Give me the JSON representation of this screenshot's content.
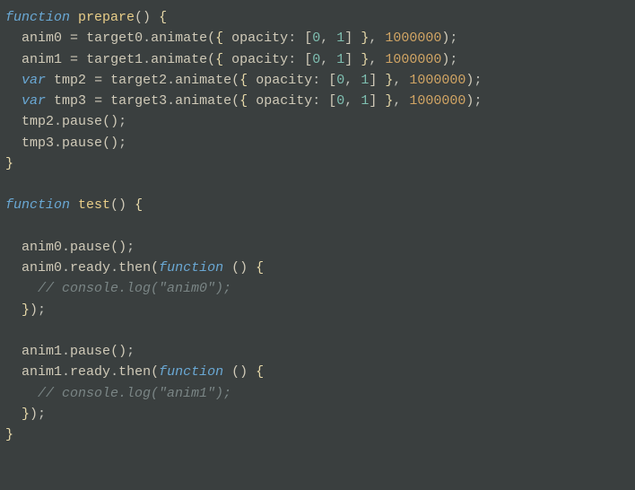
{
  "code": {
    "fn1_keyword": "function",
    "fn1_name": "prepare",
    "fn2_keyword": "function",
    "fn2_name": "test",
    "var_keyword": "var",
    "anim0": "anim0",
    "anim1": "anim1",
    "tmp2": "tmp2",
    "tmp3": "tmp3",
    "target0": "target0",
    "target1": "target1",
    "target2": "target2",
    "target3": "target3",
    "animate": "animate",
    "pause": "pause",
    "ready": "ready",
    "then": "then",
    "opacity": "opacity",
    "zero": "0",
    "one": "1",
    "duration": "1000000",
    "anon_fn": "function",
    "comment0": "// console.log(\"anim0\");",
    "comment1": "// console.log(\"anim1\");"
  }
}
